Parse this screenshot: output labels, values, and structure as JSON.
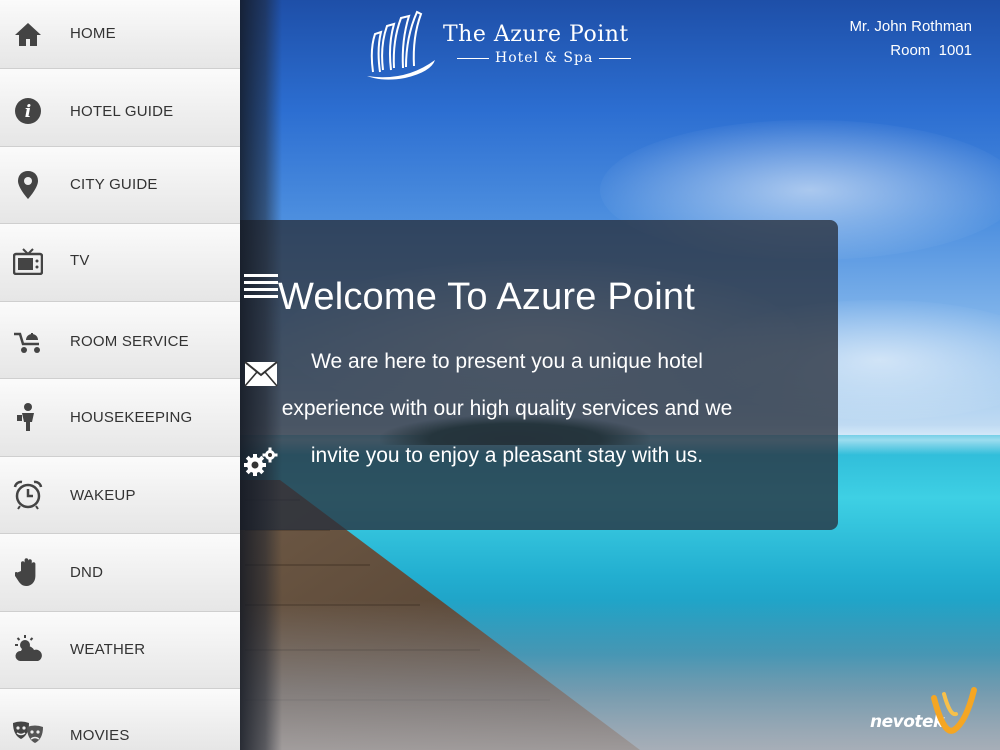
{
  "menu": {
    "items": [
      {
        "label": "HOME",
        "icon": "home-icon"
      },
      {
        "label": "HOTEL GUIDE",
        "icon": "info-icon"
      },
      {
        "label": "CITY GUIDE",
        "icon": "map-pin-icon"
      },
      {
        "label": "TV",
        "icon": "tv-icon"
      },
      {
        "label": "ROOM SERVICE",
        "icon": "room-service-cart-icon"
      },
      {
        "label": "HOUSEKEEPING",
        "icon": "housekeeper-icon"
      },
      {
        "label": "WAKEUP",
        "icon": "alarm-clock-icon"
      },
      {
        "label": "DND",
        "icon": "hand-icon"
      },
      {
        "label": "WEATHER",
        "icon": "weather-icon"
      },
      {
        "label": "MOVIES",
        "icon": "theater-masks-icon"
      }
    ]
  },
  "strip_icons": [
    "menu-icon",
    "envelope-icon",
    "gears-icon"
  ],
  "logo": {
    "line1": "The Azure Point",
    "line2": "Hotel & Spa"
  },
  "guest": {
    "name": "Mr. John Rothman",
    "room": "Room  1001"
  },
  "welcome": {
    "title": "Welcome To Azure Point",
    "body": "We are here to present you a unique hotel experience with our high quality services and we invite you to enjoy a pleasant stay with us."
  },
  "brand": {
    "name": "nevotek"
  },
  "colors": {
    "sidebar_bg": "#f0f0f0",
    "panel_bg": "#28303c",
    "brand_accent": "#f5a623"
  }
}
